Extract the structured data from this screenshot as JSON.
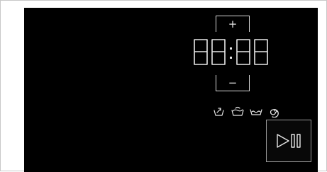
{
  "controls": {
    "plus_label": "+",
    "minus_label": "−"
  },
  "display": {
    "time": "88:88"
  },
  "program_icons": [
    "prewash-icon",
    "wash-icon",
    "rinse-icon",
    "spin-icon"
  ],
  "colors": {
    "panel_background": "#000000",
    "foreground": "#e8e8e8",
    "page_background": "#ffffff"
  }
}
